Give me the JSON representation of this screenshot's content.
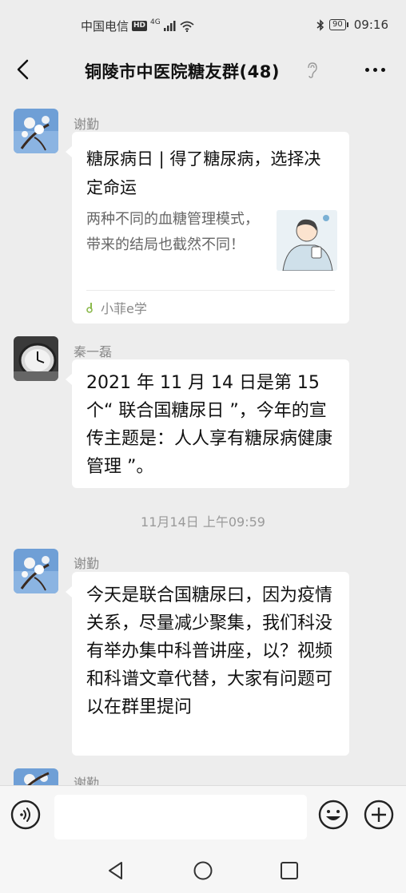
{
  "status_bar": {
    "carrier": "中国电信",
    "hd": "HD",
    "network": "4G",
    "battery": "90",
    "time": "09:16"
  },
  "header": {
    "title": "铜陵市中医院糖友群(48)",
    "back_icon": "chevron-left-icon",
    "muted_icon": "ear-icon",
    "more_icon": "more-dots-icon"
  },
  "messages": [
    {
      "sender": "谢勤",
      "type": "article",
      "title": "糖尿病日 | 得了糖尿病，选择决定命运",
      "description": "两种不同的血糖管理模式，带来的结局也截然不同！",
      "source": "小菲e学"
    },
    {
      "sender": "秦一磊",
      "type": "text",
      "text": "2021 年 11 月 14 日是第 15 个“ 联合国糖尿日 ”，今年的宣传主题是：人人享有糖尿病健康管理 ”。"
    },
    {
      "type": "timestamp",
      "text": "11月14日 上午09:59"
    },
    {
      "sender": "谢勤",
      "type": "text",
      "text": "今天是联合国糖尿曰，因为疫情关系，尽量减少聚集，我们科没有举办集中科普讲座，以？视频和科谱文章代替，大家有问题可以在群里提问"
    },
    {
      "sender": "谢勤",
      "type": "partial"
    }
  ],
  "input": {
    "value": "",
    "voice_icon": "voice-icon",
    "emoji_icon": "emoji-icon",
    "plus_icon": "plus-icon"
  },
  "system_nav": {
    "back_icon": "triangle-back-icon",
    "home_icon": "circle-home-icon",
    "recent_icon": "square-recent-icon"
  },
  "colors": {
    "background": "#ededed",
    "bubble": "#ffffff",
    "sender": "#8a8a8a"
  }
}
